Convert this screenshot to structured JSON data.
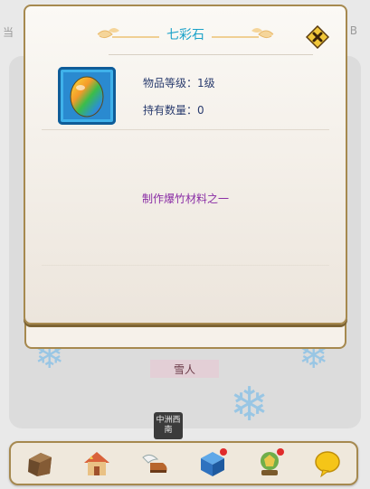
{
  "background": {
    "header_left": "当",
    "header_right": "B",
    "npc_name": "雪人",
    "badge_text": "中洲西南"
  },
  "modal": {
    "title": "七彩石",
    "item_icon": "rainbow-stone-icon",
    "level_label": "物品等级：",
    "level_value": "1级",
    "count_label": "持有数量：",
    "count_value": "0",
    "description": "制作爆竹材料之一",
    "close_icon": "close-icon"
  },
  "toolbar": {
    "buttons": [
      {
        "icon": "backpack-icon"
      },
      {
        "icon": "house-icon"
      },
      {
        "icon": "winged-shoe-icon"
      },
      {
        "icon": "cube-icon",
        "notification": true
      },
      {
        "icon": "trophy-icon",
        "notification": true
      },
      {
        "icon": "chat-bubble-icon"
      }
    ]
  },
  "colors": {
    "accent_title": "#1aa2c9",
    "description_text": "#8a2da5",
    "frame_border": "#a6894f"
  }
}
